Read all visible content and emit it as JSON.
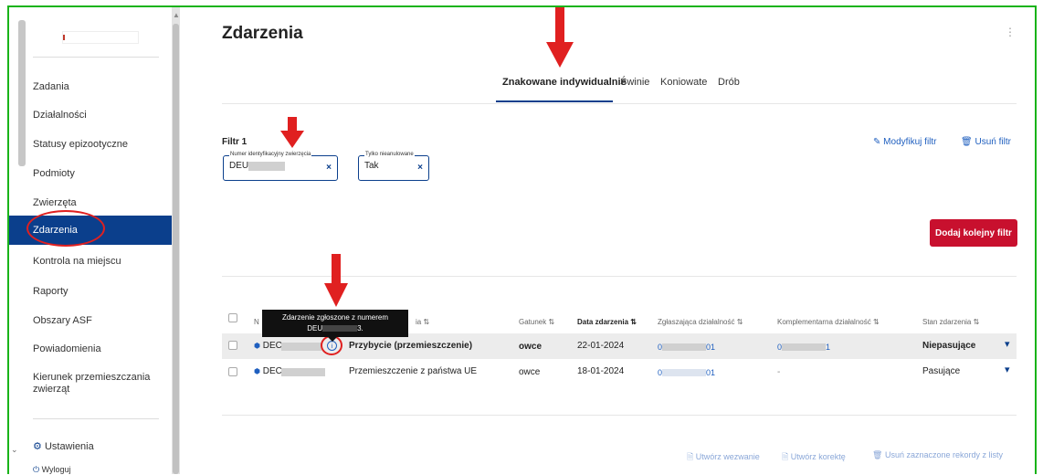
{
  "sidebar": {
    "items": [
      {
        "label": "Zadania"
      },
      {
        "label": "Działalności"
      },
      {
        "label": "Statusy epizootyczne"
      },
      {
        "label": "Podmioty"
      },
      {
        "label": "Zwierzęta"
      },
      {
        "label": "Zdarzenia",
        "active": true
      },
      {
        "label": "Kontrola na miejscu"
      },
      {
        "label": "Raporty"
      },
      {
        "label": "Obszary ASF"
      },
      {
        "label": "Powiadomienia"
      },
      {
        "label": "Kierunek przemieszczania zwierząt"
      }
    ],
    "settings_label": "Ustawienia",
    "logout_label": "Wyloguj"
  },
  "page": {
    "title": "Zdarzenia",
    "tabs": [
      {
        "label": "Znakowane indywidualnie",
        "active": true
      },
      {
        "label": "Świnie"
      },
      {
        "label": "Koniowate"
      },
      {
        "label": "Drób"
      }
    ]
  },
  "filter": {
    "title": "Filtr 1",
    "modify_label": "Modyfikuj filtr",
    "remove_label": "Usuń filtr",
    "chips": [
      {
        "label": "Numer identyfikacyjny zwierzęcia",
        "value": "DEU"
      },
      {
        "label": "Tylko nieanulowane",
        "value": "Tak"
      }
    ],
    "add_button": "Dodaj kolejny filtr"
  },
  "table": {
    "headers": {
      "number": "N",
      "type": "ia",
      "species": "Gatunek",
      "date": "Data zdarzenia",
      "reporting": "Zgłaszająca działalność",
      "complementary": "Komplementarna działalność",
      "status": "Stan zdarzenia"
    },
    "rows": [
      {
        "id": "DEC",
        "type": "Przybycie (przemieszczenie)",
        "species": "owce",
        "date": "22-01-2024",
        "reporting_prefix": "0",
        "reporting_suffix": "01",
        "complementary_prefix": "0",
        "complementary_suffix": "1",
        "status": "Niepasujące"
      },
      {
        "id": "DEC",
        "type": "Przemieszczenie z państwa UE",
        "species": "owce",
        "date": "18-01-2024",
        "reporting_prefix": "0",
        "reporting_suffix": "01",
        "complementary": "-",
        "status": "Pasujące"
      }
    ],
    "tooltip": {
      "line1": "Zdarzenie zgłoszone z numerem",
      "line2_prefix": "DEU",
      "line2_suffix": "3."
    }
  },
  "footer": {
    "create_summons": "Utwórz wezwanie",
    "create_correction": "Utwórz korektę",
    "remove_selected": "Usuń zaznaczone rekordy z listy"
  },
  "colors": {
    "accent": "#0b3f8c",
    "danger": "#c8102e",
    "annotation": "#e02020",
    "frame": "#19b319"
  }
}
